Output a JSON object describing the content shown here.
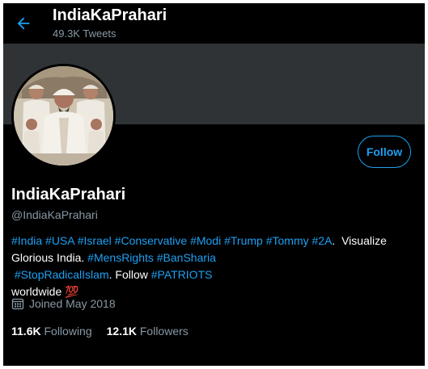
{
  "header": {
    "title": "IndiaKaPrahari",
    "tweet_count": "49.3K Tweets"
  },
  "profile": {
    "display_name": "IndiaKaPrahari",
    "handle": "@IndiaKaPrahari",
    "follow_label": "Follow",
    "bio": {
      "line1": [
        {
          "text": "#India",
          "type": "hashtag"
        },
        {
          "text": " ",
          "type": "text"
        },
        {
          "text": "#USA",
          "type": "hashtag"
        },
        {
          "text": " ",
          "type": "text"
        },
        {
          "text": "#Israel",
          "type": "hashtag"
        },
        {
          "text": " ",
          "type": "text"
        },
        {
          "text": "#Conservative",
          "type": "hashtag"
        },
        {
          "text": " ",
          "type": "text"
        },
        {
          "text": "#Modi",
          "type": "hashtag"
        },
        {
          "text": " ",
          "type": "text"
        },
        {
          "text": "#Trump",
          "type": "hashtag"
        },
        {
          "text": " ",
          "type": "text"
        },
        {
          "text": "#Tommy",
          "type": "hashtag"
        },
        {
          "text": " ",
          "type": "text"
        },
        {
          "text": "#2A",
          "type": "hashtag"
        },
        {
          "text": ".  Visualize",
          "type": "text"
        }
      ],
      "line2": [
        {
          "text": "Glorious India. ",
          "type": "text"
        },
        {
          "text": "#MensRights",
          "type": "hashtag"
        },
        {
          "text": " ",
          "type": "text"
        },
        {
          "text": "#BanSharia",
          "type": "hashtag"
        },
        {
          "text": " ",
          "type": "text"
        },
        {
          "text": "#StopRadicalIslam",
          "type": "hashtag"
        },
        {
          "text": ". Follow ",
          "type": "text"
        },
        {
          "text": "#PATRIOTS",
          "type": "hashtag"
        }
      ],
      "line3": [
        {
          "text": "worldwide ",
          "type": "text"
        },
        {
          "text": "💯",
          "type": "emoji"
        }
      ]
    },
    "joined": "Joined May 2018",
    "following_count": "11.6K",
    "following_label": "Following",
    "followers_count": "12.1K",
    "followers_label": "Followers"
  },
  "colors": {
    "background": "#000000",
    "accent": "#1da1f2",
    "muted": "#8899a6",
    "banner": "#2f3336"
  },
  "icons": {
    "back": "arrow-left-icon",
    "calendar": "calendar-icon"
  }
}
